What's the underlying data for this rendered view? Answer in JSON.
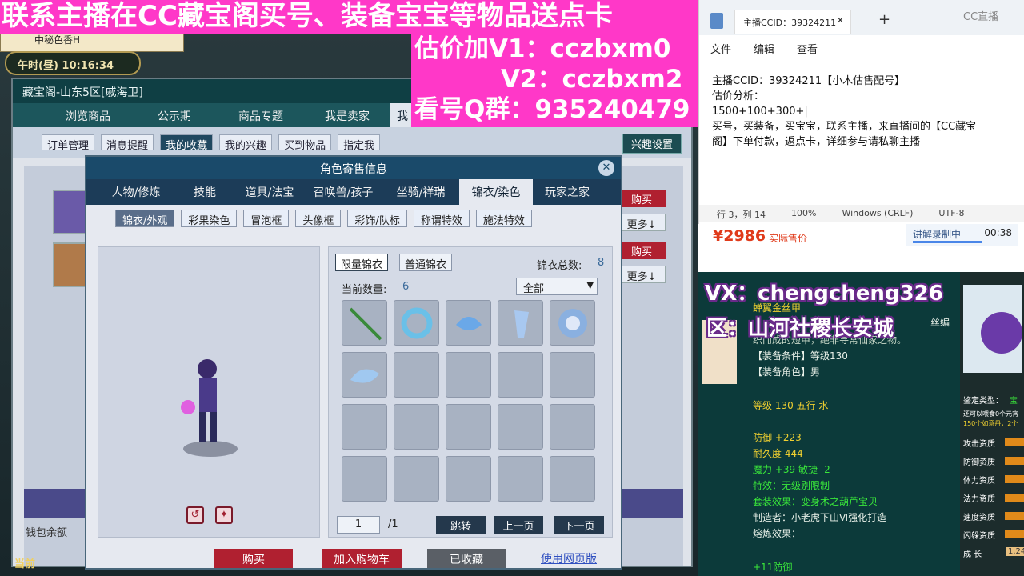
{
  "game": {
    "window_tab": "中秘色香H",
    "clock": "午时(昼) 10:16:34",
    "store_title": "藏宝阁-山东5区[戚海卫]",
    "store_tabs": [
      "浏览商品",
      "公示期",
      "商品专题",
      "我是卖家",
      "我"
    ],
    "store_subtabs": [
      "订单管理",
      "消息提醒",
      "我的收藏",
      "我的兴趣",
      "买到物品",
      "指定我"
    ],
    "store_subtab_active": 2,
    "interest_btn": "兴趣设置",
    "buy_label": "购买",
    "more_label": "更多↓",
    "wallet_label": "钱包余额",
    "bottom_label": "当前"
  },
  "overlay": {
    "line1": "联系主播在CC藏宝阁买号、装备宝宝等物品送点卡",
    "line2": "估价加V1：cczbxm0",
    "line3": "V2：cczbxm2",
    "line4": "看号Q群：935240479"
  },
  "dialog": {
    "title": "角色寄售信息",
    "tabs": [
      "人物/修炼",
      "技能",
      "道具/法宝",
      "召唤兽/孩子",
      "坐骑/祥瑞",
      "锦衣/染色",
      "玩家之家"
    ],
    "tab_active": 5,
    "subtabs": [
      "锦衣/外观",
      "彩果染色",
      "冒泡框",
      "头像框",
      "彩饰/队标",
      "称谓特效",
      "施法特效"
    ],
    "subtab_active": 0,
    "panel": {
      "tab_limited": "限量锦衣",
      "tab_normal": "普通锦衣",
      "total_label": "锦衣总数:",
      "total_value": "8",
      "count_label": "当前数量:",
      "count_value": "6",
      "filter_value": "全部",
      "page_current": "1",
      "page_total": "/1",
      "jump": "跳转",
      "prev": "上一页",
      "next": "下一页"
    },
    "buy": "购买",
    "cart": "加入购物车",
    "favorited": "已收藏",
    "web": "使用网页版"
  },
  "notepad": {
    "tab_title": "主播CCID：39324211",
    "menu": [
      "文件",
      "编辑",
      "查看"
    ],
    "lines": [
      "主播CCID：39324211【小木估售配号】",
      "估价分析：",
      "1500+100+300+|",
      "买号，买装备，买宝宝，联系主播，来直播间的【CC藏宝",
      "阁】下单付款，返点卡，详细参与请私聊主播"
    ],
    "status": [
      "行 3，列 14",
      "100%",
      "Windows (CRLF)",
      "UTF-8"
    ]
  },
  "stream": {
    "watermark": "CC直播",
    "price": "¥2986",
    "price_label": "实际售价",
    "rec_label": "讲解录制中",
    "rec_time": "00:38",
    "vx": "VX：chengcheng326",
    "region": "区：山河社稷长安城"
  },
  "item_info": {
    "lines": [
      "蝉翼金丝甲",
      "织而成的短甲，绝非寻常仙家之物。",
      "【装备条件】等级130",
      "【装备角色】男",
      "",
      "等级 130 五行 水",
      "",
      "防御 +223",
      "耐久度 444",
      "魔力 +39 敏捷 -2",
      "特效：无级别限制",
      "套装效果：变身术之葫芦宝贝",
      "制造者：小老虎下山Ⅵ强化打造",
      "熔炼效果：",
      "",
      "+11防御"
    ],
    "side_label": "丝编"
  },
  "pet_panel": {
    "type_label": "鉴定类型：",
    "type_value": "宝",
    "note": "还可以喂食0个元宵",
    "note2": "150个如意丹，2个",
    "rows": [
      "攻击资质",
      "防御资质",
      "体力资质",
      "法力资质",
      "速度资质",
      "闪躲资质"
    ],
    "growth": "成  长",
    "growth_val": "1.24"
  },
  "colors": {
    "overlay": "#ff38c8",
    "buy": "#b02030",
    "dialog_head": "#1a4a6a"
  }
}
